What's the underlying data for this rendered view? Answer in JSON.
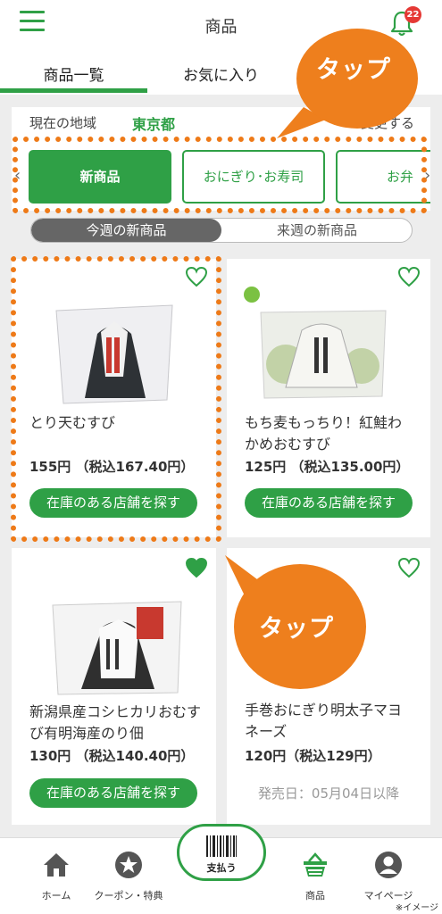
{
  "header": {
    "title": "商品",
    "notification_count": "22"
  },
  "tabs": [
    {
      "label": "商品一覧"
    },
    {
      "label": "お気に入り"
    }
  ],
  "region": {
    "label": "現在の地域",
    "value": "東京都",
    "change": "変更する"
  },
  "categories": [
    {
      "label": "新商品"
    },
    {
      "label": "おにぎり･お寿司"
    },
    {
      "label": "お弁"
    }
  ],
  "week_toggle": {
    "this_week": "今週の新商品",
    "next_week": "来週の新商品"
  },
  "products": [
    {
      "name": "とり天むすび",
      "price": "155円 （税込167.40円）",
      "button": "在庫のある店舗を探す",
      "favorite": false
    },
    {
      "name": "もち麦もっちり！紅鮭わかめおむすび",
      "price": "125円 （税込135.00円）",
      "button": "在庫のある店舗を探す",
      "favorite": false
    },
    {
      "name": "新潟県産コシヒカリおむすび有明海産のり佃",
      "price": "130円 （税込140.40円）",
      "button": "在庫のある店舗を探す",
      "favorite": true
    },
    {
      "name": "手巻おにぎり明太子マヨネーズ",
      "price": "120円（税込129円）",
      "release": "発売日：05月04日以降",
      "favorite": false
    }
  ],
  "callouts": [
    {
      "text": "タップ"
    },
    {
      "text": "タップ"
    }
  ],
  "bottom_nav": [
    {
      "label": "ホーム",
      "icon": "home-icon"
    },
    {
      "label": "クーポン・特典",
      "icon": "star-icon"
    },
    {
      "label": "支払う",
      "icon": "barcode-icon"
    },
    {
      "label": "商品",
      "icon": "basket-icon"
    },
    {
      "label": "マイページ",
      "icon": "user-icon"
    }
  ],
  "note": "※イメージ",
  "colors": {
    "brand_green": "#2fa046",
    "callout_orange": "#ee7f1d",
    "badge_red": "#e53935"
  }
}
